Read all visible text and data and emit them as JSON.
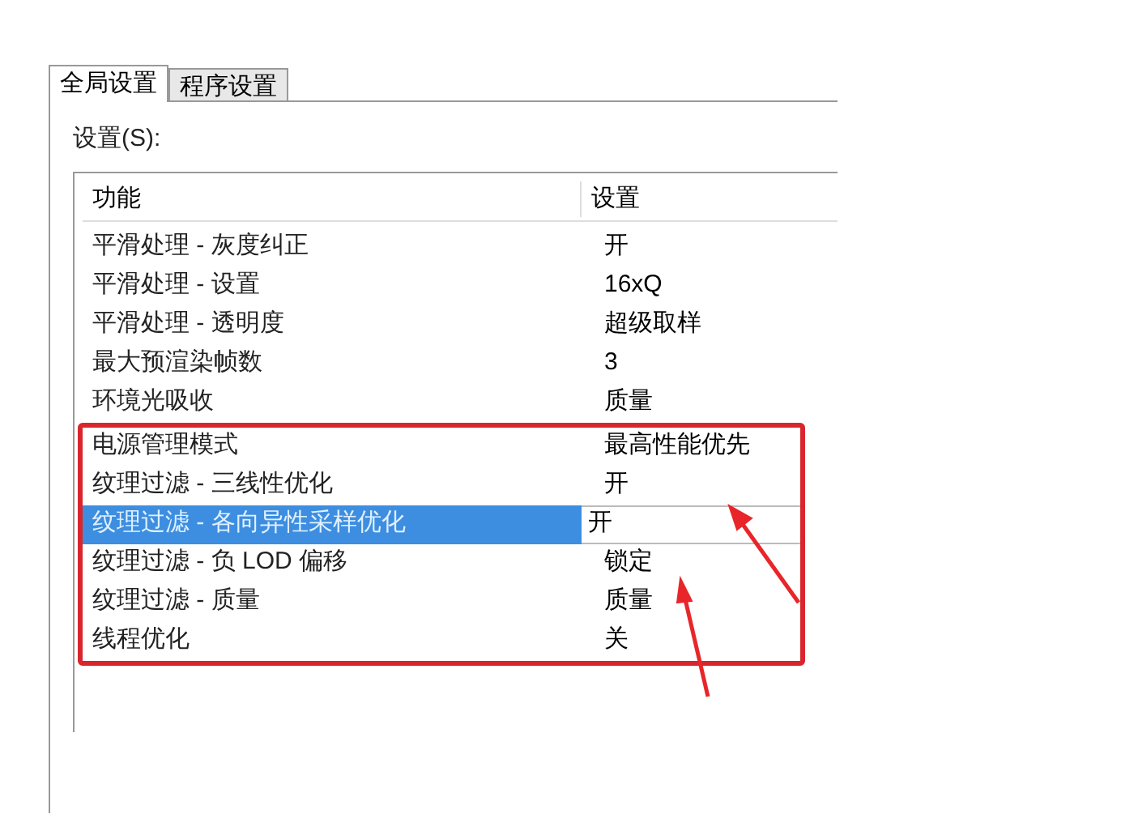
{
  "tabs": [
    {
      "label": "全局设置",
      "selected": true
    },
    {
      "label": "程序设置",
      "selected": false
    }
  ],
  "settings_label": "设置(S):",
  "table": {
    "columns": [
      "功能",
      "设置"
    ],
    "row_groups": [
      {
        "highlighted": false,
        "rows": [
          {
            "feature": "平滑处理 - 灰度纠正",
            "setting": "开",
            "selected": false
          },
          {
            "feature": "平滑处理 - 设置",
            "setting": "16xQ",
            "selected": false
          },
          {
            "feature": "平滑处理 - 透明度",
            "setting": "超级取样",
            "selected": false
          },
          {
            "feature": "最大预渲染帧数",
            "setting": "3",
            "selected": false
          },
          {
            "feature": "环境光吸收",
            "setting": "质量",
            "selected": false
          }
        ]
      },
      {
        "highlighted": true,
        "rows": [
          {
            "feature": "电源管理模式",
            "setting": "最高性能优先",
            "selected": false
          },
          {
            "feature": "纹理过滤 - 三线性优化",
            "setting": "开",
            "selected": false
          },
          {
            "feature": "纹理过滤 - 各向异性采样优化",
            "setting": "开",
            "selected": true
          },
          {
            "feature": "纹理过滤 - 负 LOD 偏移",
            "setting": "锁定",
            "selected": false
          },
          {
            "feature": "纹理过滤 - 质量",
            "setting": "质量",
            "selected": false
          },
          {
            "feature": "线程优化",
            "setting": "关",
            "selected": false
          }
        ]
      }
    ]
  }
}
